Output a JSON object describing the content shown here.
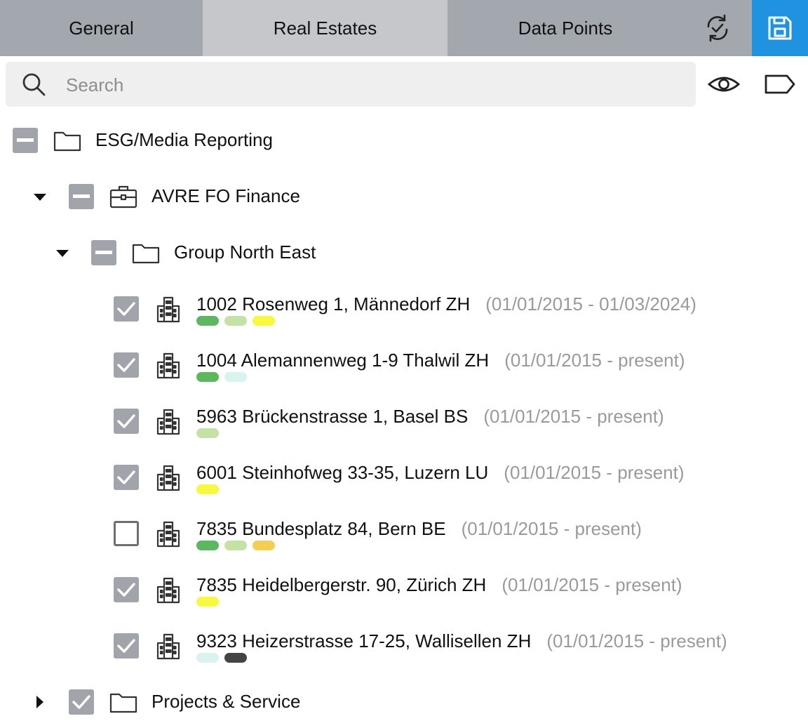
{
  "tabs": [
    {
      "label": "General",
      "active": false
    },
    {
      "label": "Real Estates",
      "active": true
    },
    {
      "label": "Data Points",
      "active": false
    }
  ],
  "toolbar": {
    "sync_icon": "sync-check-icon",
    "save_icon": "save-icon",
    "accent": "#1f93e0"
  },
  "search": {
    "placeholder": "Search",
    "value": ""
  },
  "tree": {
    "root": {
      "label": "ESG/Media Reporting",
      "state": "partial"
    },
    "portfolio": {
      "label": "AVRE FO Finance",
      "state": "partial",
      "expanded": true
    },
    "group": {
      "label": "Group North East",
      "state": "partial",
      "expanded": true
    },
    "properties": [
      {
        "name": "1002 Rosenweg 1, Männedorf ZH",
        "period": "(01/01/2015 - 01/03/2024)",
        "checked": true,
        "tags": [
          "#5cb85c",
          "#c3e3a5",
          "#f7f93a"
        ]
      },
      {
        "name": "1004 Alemannenweg 1-9 Thalwil ZH",
        "period": "(01/01/2015 - present)",
        "checked": true,
        "tags": [
          "#5cb85c",
          "#d9f3ef"
        ]
      },
      {
        "name": "5963 Brückenstrasse 1, Basel BS",
        "period": "(01/01/2015 - present)",
        "checked": true,
        "tags": [
          "#c3e3a5"
        ]
      },
      {
        "name": "6001 Steinhofweg 33-35, Luzern LU",
        "period": "(01/01/2015 - present)",
        "checked": true,
        "tags": [
          "#f7f93a"
        ]
      },
      {
        "name": "7835 Bundesplatz 84, Bern BE",
        "period": "(01/01/2015 - present)",
        "checked": false,
        "tags": [
          "#5cb85c",
          "#c3e3a5",
          "#f4cf4f"
        ]
      },
      {
        "name": "7835 Heidelbergerstr. 90, Zürich ZH",
        "period": "(01/01/2015 - present)",
        "checked": true,
        "tags": [
          "#f7f93a"
        ]
      },
      {
        "name": "9323 Heizerstrasse 17-25, Wallisellen ZH",
        "period": "(01/01/2015 - present)",
        "checked": true,
        "tags": [
          "#d9f3ef",
          "#444444"
        ]
      }
    ],
    "sibling": {
      "label": "Projects & Service",
      "state": "checked",
      "expanded": false
    }
  }
}
